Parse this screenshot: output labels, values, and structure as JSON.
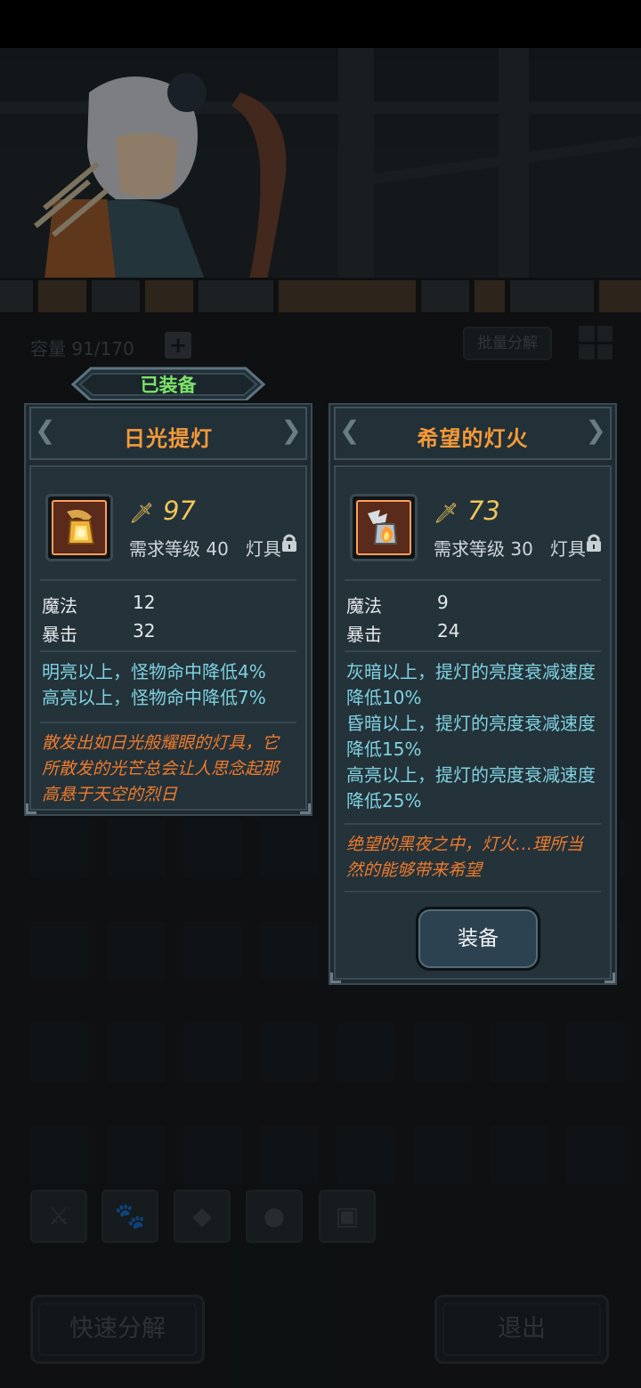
{
  "inventory": {
    "capacity_label": "容量 91/170",
    "batch_decompose": "批量分解",
    "quick_decompose": "快速分解",
    "exit": "退出"
  },
  "equipped_tag": "已装备",
  "left_card": {
    "title": "日光提灯",
    "power": "97",
    "requirement": "需求等级 40",
    "type": "灯具",
    "stats": [
      {
        "label": "魔法",
        "value": "12"
      },
      {
        "label": "暴击",
        "value": "32"
      }
    ],
    "effects": [
      "明亮以上，怪物命中降低4%",
      "高亮以上，怪物命中降低7%"
    ],
    "flavor_lines": [
      "散发出如日光般耀眼的灯具，它",
      "所散发的光芒总会让人思念起那",
      "高悬于天空的烈日"
    ]
  },
  "right_card": {
    "title": "希望的灯火",
    "power": "73",
    "requirement": "需求等级 30",
    "type": "灯具",
    "stats": [
      {
        "label": "魔法",
        "value": "9"
      },
      {
        "label": "暴击",
        "value": "24"
      }
    ],
    "effects": [
      "灰暗以上，提灯的亮度衰减速度",
      "降低10%",
      "昏暗以上，提灯的亮度衰减速度",
      "降低15%",
      "高亮以上，提灯的亮度衰减速度",
      "降低25%"
    ],
    "flavor_lines": [
      "绝望的黑夜之中，灯火…理所当",
      "然的能够带来希望"
    ],
    "equip_button": "装备"
  },
  "colors": {
    "title_orange": "#f59a38",
    "effect_cyan": "#7fd2e0",
    "flavor_orange": "#ee7b2c",
    "power_gold": "#f0c65a",
    "equipped_green": "#7de36a"
  },
  "icons": {
    "power": "sword-spark-icon",
    "lock": "lock-icon",
    "left_item": "sun-lantern-icon",
    "right_item": "hope-flame-icon"
  }
}
